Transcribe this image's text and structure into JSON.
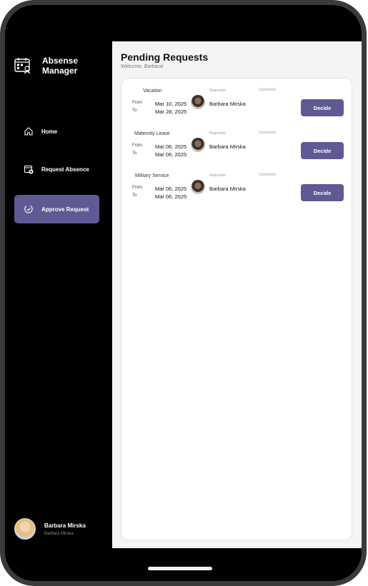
{
  "app": {
    "title": "Absense Manager"
  },
  "sidebar": {
    "items": [
      {
        "label": "Home",
        "icon": "home-icon"
      },
      {
        "label": "Request Absence",
        "icon": "calendar-add-icon"
      },
      {
        "label": "Approve Request",
        "icon": "approve-icon",
        "active": true
      }
    ],
    "user": {
      "name": "Barbara Mirska",
      "subtitle": "Barbara Mirska"
    }
  },
  "main": {
    "title": "Pending Requests",
    "subtitle": "Welcome, Barbara!",
    "labels": {
      "from": "From",
      "to": "To",
      "requestor": "Requestor",
      "comments": "Comments",
      "decide": "Decide"
    },
    "requests": [
      {
        "type": "Vacation",
        "from": "Mar 10, 2025",
        "to": "Mar 28, 2025",
        "requestor": "Barbara Mirska"
      },
      {
        "type": "Maternity Leave",
        "from": "Mar 06, 2025",
        "to": "Mar 06, 2025",
        "requestor": "Barbara Mirska"
      },
      {
        "type": "Military Service",
        "from": "Mar 06, 2025",
        "to": "Mar 06, 2025",
        "requestor": "Barbara Mirska"
      }
    ]
  },
  "colors": {
    "accent": "#5f5994",
    "sidebar_bg": "#000000",
    "main_bg": "#f4f4f4"
  }
}
